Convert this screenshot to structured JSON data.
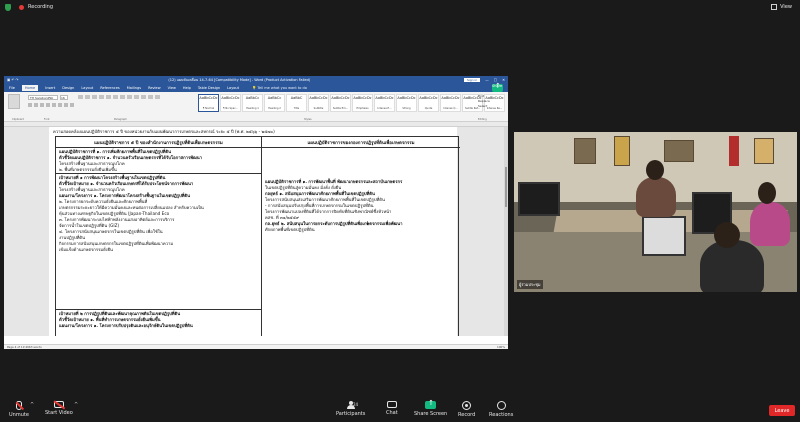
{
  "zoom": {
    "recording_label": "Recording",
    "view_label": "View",
    "controls": {
      "unmute": "Unmute",
      "start_video": "Start Video",
      "participants": "Participants",
      "participants_count": "24",
      "chat": "Chat",
      "share_screen": "Share Screen",
      "record": "Record",
      "reactions": "Reactions",
      "leave": "Leave"
    },
    "colors": {
      "share_green": "#12b981",
      "leave_red": "#e02828",
      "word_blue": "#2b579a"
    }
  },
  "word": {
    "window_title": "(12) แผนขับเคลื่อน 14-7-64 [Compatibility Mode] - Word (Product Activation Failed)",
    "sign_in": "Sign in",
    "tabs": [
      "File",
      "Home",
      "Insert",
      "Design",
      "Layout",
      "References",
      "Mailings",
      "Review",
      "View",
      "Help",
      "Table Design",
      "Layout"
    ],
    "tell_me": "Tell me what you want to do",
    "share": "Share",
    "font_name": "TH SarabunPSK",
    "font_size": "16",
    "styles": [
      {
        "preview": "AaBbCcDc",
        "name": "¶ Normal"
      },
      {
        "preview": "AaBbCcDc",
        "name": "¶ No Spac..."
      },
      {
        "preview": "AaBbCc",
        "name": "Heading 1"
      },
      {
        "preview": "AaBbCc",
        "name": "Heading 2"
      },
      {
        "preview": "AaBbC",
        "name": "Title"
      },
      {
        "preview": "AaBbCcDc",
        "name": "Subtitle"
      },
      {
        "preview": "AaBbCcDc",
        "name": "Subtle Em..."
      },
      {
        "preview": "AaBbCcDc",
        "name": "Emphasis"
      },
      {
        "preview": "AaBbCcDc",
        "name": "Intense E..."
      },
      {
        "preview": "AaBbCcDc",
        "name": "Strong"
      },
      {
        "preview": "AaBbCcDc",
        "name": "Quote"
      },
      {
        "preview": "AaBbCcDc",
        "name": "Intense Q..."
      },
      {
        "preview": "AaBbCcDc",
        "name": "Subtle Ref..."
      },
      {
        "preview": "AaBbCcDc",
        "name": "Intense Re..."
      }
    ],
    "editing": [
      "Find",
      "Replace",
      "Select"
    ],
    "group_labels": [
      "Clipboard",
      "Font",
      "Paragraph",
      "Styles",
      "Editing"
    ],
    "status_left": "Page 4 of 19   4063 words",
    "status_zoom": "100%",
    "document": {
      "top_line": "ความสอดคล้องแผนปฏิบัติราชการ ๕ ปี ของหน่วยงานกับแผนพัฒนาการเกษตรและสหกรณ์ ระยะ ๕ ปี (พ.ศ. ๒๕๖๖ - ๒๕๗๐)",
      "header_left": "แผนปฏิบัติราชการ ๕ ปี ของสำนักงานการปฏิรูปที่ดินเพื่อเกษตรกรรม",
      "header_right": "แผนปฏิบัติราชการของกองการปฏิรูปที่ดินเพื่อเกษตรกรรม",
      "left_block1": [
        "แผนปฏิบัติราชการที่ ๑. การเพิ่มศักยภาพพื้นที่ในเขตปฏิรูปที่ดิน",
        "ตัวชี้วัดแผนปฏิบัติราชการ   ๑. จำนวนครัวเรือนเกษตรกรที่ได้รับโอกาสการพัฒนา",
        "                                       โครงสร้างพื้นฐานและสาธารณูปโภค",
        "                                       ๒. พื้นที่เกษตรกรรมยั่งยืนเพิ่มขึ้น"
      ],
      "left_block2": [
        "เป้าหมายที่ ๑            การพัฒนาโครงสร้างพื้นฐานในเขตปฏิรูปที่ดิน",
        "ตัวชี้วัดเป้าหมาย        ๑. จำนวนครัวเรือนเกษตรที่ได้รับประโยชน์จากการพัฒนา",
        "                                  โครงสร้างพื้นฐานและสาธารณูปโภค",
        "แผนงาน/โครงการ        ๑. โครงการพัฒนาโครงสร้างพื้นฐานในเขตปฏิรูปที่ดิน",
        "                                  ๒. โครงการยกระดับความยั่งยืนและศักยภาพพื้นที่",
        "เกษตรกรรมระยะยาวให้มีความมั่นคงและทนต่อการเปลี่ยนแปลง สำหรับความเป็น",
        "หุ้นส่วนทางเศรษฐกิจในเขตปฏิรูปที่ดิน (Japan-Thailand Eco",
        "                                  ๓. โครงการพัฒนาระบบไฟฟ้าพลังงานแสงอาทิตย์และการบริการ",
        "                                  จัดการน้ำในเขตปฏิรูปที่ดิน (GIZ)",
        "                                  ๔. โครงการสนับสนุนเกษตรกรในเขตปฏิรูปที่ดิน เพื่อใช้ใน",
        "                                  งานปฏิรูปที่ดิน",
        "                                  กิจกรรมการสนับสนุนเกษตรกรในเขตปฏิรูปที่ดินเพื่อพัฒนาความ",
        "                                  เข้มแข็งด้านเกษตรกรรมยั่งยืน"
      ],
      "left_block3": [
        "เป้าหมายที่ ๒            การปฏิรูปที่ดินและพัฒนาคุณภาพดินในเขตปฏิรูปที่ดิน",
        "ตัวชี้วัดเป้าหมาย        ๑. พื้นที่ทำการเกษตรกรรมยั่งยืนเพิ่มขึ้น",
        "แผนงาน/โครงการ        ๑. โครงการปรับปรุงดินและอนุรักษ์ดินในเขตปฏิรูปที่ดิน"
      ],
      "right_block": [
        "แผนปฏิบัติราชการที่ ๑. การพัฒนาพื้นที่ พัฒนาเกษตรกรและสถาบันเกษตรกร",
        "ในเขตปฏิรูปที่ดินสู่ความมั่นคง มั่งคั่ง ยั่งยืน",
        "กลยุทธ์ ๑. สนับสนุนการพัฒนาศักยภาพพื้นที่ในเขตปฏิรูปที่ดิน",
        "  โครงการสนับสนุนส่งเสริมการพัฒนาศักยภาพพื้นที่ในเขตปฏิรูปที่ดิน",
        "    - การสนับสนุนปรับปรุงพื้นที่การเกษตรกรรมในเขตปฏิรูปที่ดิน",
        "  โครงการพัฒนาแปลงที่ดินที่ได้จากการปิดทับที่ดินเชิงพาณิชย์ซึ่งหัวหน้า",
        "    คสช. ที่ ๓๑/๒๕๕๙",
        "",
        "กล.ยุทธ์ ๒. สนับสนุนในการยกระดับการปฏิรูปที่ดินเพื่อเกษตรกรรมเพื่อพัฒนา",
        "  ศักยภาพพื้นที่เขตปฏิรูปที่ดิน"
      ]
    }
  },
  "video": {
    "participant_name": "ผู้ร่วมประชุม"
  }
}
